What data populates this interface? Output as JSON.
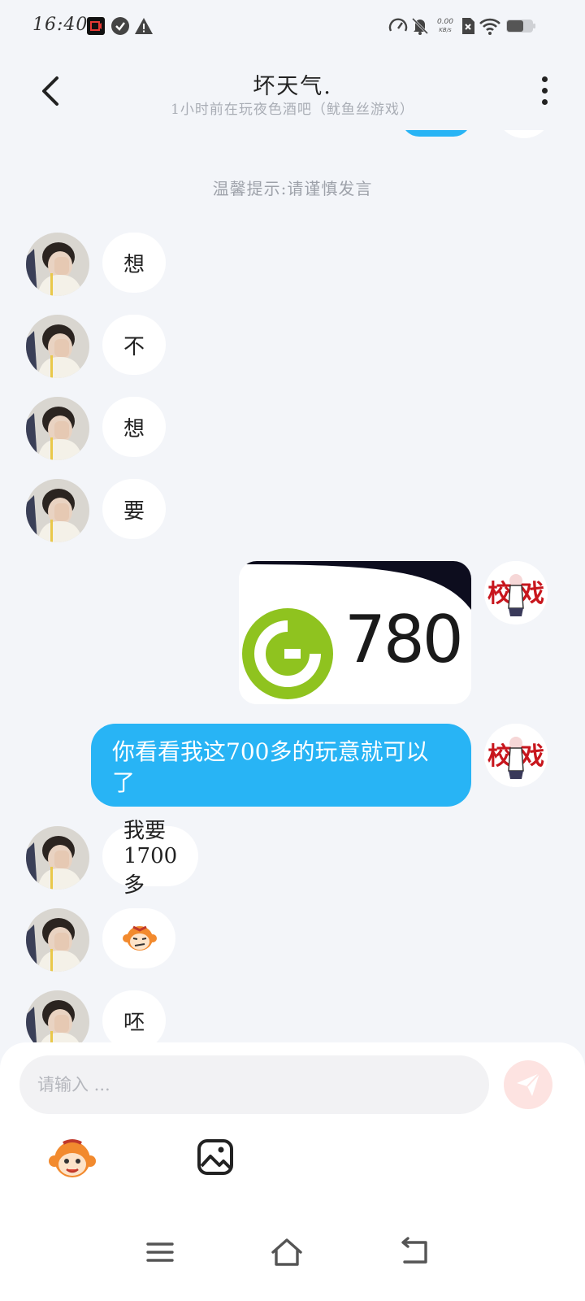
{
  "status_bar": {
    "time": "16:40",
    "speed_value": "0.00",
    "speed_unit": "KB/s",
    "icons": [
      "screen-record-icon",
      "check-circle-icon",
      "warning-icon",
      "speedometer-icon",
      "bell-muted-icon",
      "sim-none-icon",
      "wifi-icon",
      "battery-icon"
    ]
  },
  "header": {
    "title": "坏天气.",
    "subtitle": "1小时前在玩夜色酒吧（鱿鱼丝游戏）",
    "back_icon": "chevron-left-icon",
    "more_icon": "more-vertical-icon"
  },
  "chat": {
    "tip": "温馨提示:请谨慎发言",
    "messages": [
      {
        "side": "left",
        "type": "text",
        "text": "想"
      },
      {
        "side": "left",
        "type": "text",
        "text": "不"
      },
      {
        "side": "left",
        "type": "text",
        "text": "想"
      },
      {
        "side": "left",
        "type": "text",
        "text": "要"
      },
      {
        "side": "right",
        "type": "image",
        "image_text": "780",
        "image_icon": "green-coin-icon"
      },
      {
        "side": "right",
        "type": "text",
        "text": "你看看我这700多的玩意就可以了"
      },
      {
        "side": "left",
        "type": "text",
        "text": "我要1700多"
      },
      {
        "side": "left",
        "type": "sticker",
        "sticker": "monkey-face-sticker"
      },
      {
        "side": "left",
        "type": "text",
        "text": "呸"
      }
    ]
  },
  "input": {
    "placeholder": "请输入 ...",
    "value": "",
    "send_icon": "send-icon",
    "emoji_icon": "monkey-emoji-icon",
    "image_icon": "image-icon"
  },
  "nav": {
    "items": [
      "menu-icon",
      "home-icon",
      "back-icon"
    ]
  },
  "colors": {
    "background": "#f3f5f9",
    "bubble_out": "#28b4f5",
    "bubble_in": "#ffffff",
    "send_button": "#fde3e1"
  }
}
